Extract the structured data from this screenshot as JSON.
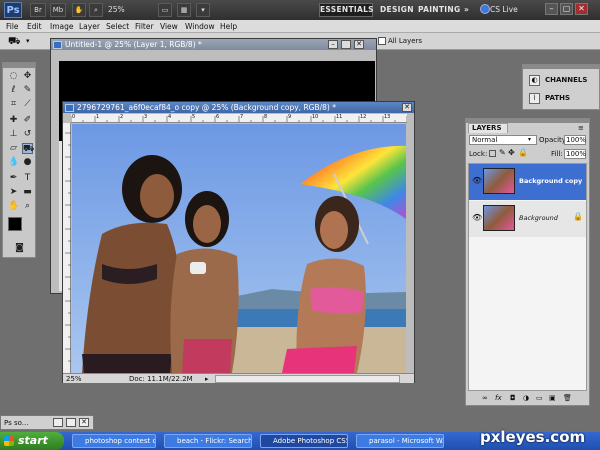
{
  "app": {
    "logo": "Ps",
    "zoom": "25%",
    "workspaces": [
      "ESSENTIALS",
      "DESIGN",
      "PAINTING"
    ],
    "more": "»",
    "cs_live": "CS Live"
  },
  "menu": [
    "File",
    "Edit",
    "Image",
    "Layer",
    "Select",
    "Filter",
    "View",
    "Window",
    "Help"
  ],
  "options": {
    "all_layers": "All Layers"
  },
  "doc_back": {
    "title": "Untitled-1 @ 25% (Layer 1, RGB/8) *"
  },
  "doc_front": {
    "title": "2796729761_a6f0ecaf84_o copy @ 25% (Background copy, RGB/8) *",
    "zoom": "25%",
    "doc_size": "Doc: 11.1M/22.2M",
    "ruler_ticks": [
      "0",
      "1",
      "2",
      "3",
      "4",
      "5",
      "6",
      "7",
      "8",
      "9",
      "10",
      "11",
      "12",
      "13",
      "14"
    ]
  },
  "dock": {
    "channels": "CHANNELS",
    "paths": "PATHS"
  },
  "layers": {
    "tab": "LAYERS",
    "blend_mode": "Normal",
    "opacity_label": "Opacity:",
    "opacity_value": "100%",
    "lock_label": "Lock:",
    "fill_label": "Fill:",
    "fill_value": "100%",
    "items": [
      {
        "name": "Background copy",
        "selected": true
      },
      {
        "name": "Background",
        "selected": false,
        "locked": true
      }
    ]
  },
  "minimized": {
    "label": "Ps so..."
  },
  "taskbar": {
    "start": "start",
    "tasks": [
      "photoshop contest o...",
      "beach - Flickr: Search...",
      "Adobe Photoshop CS5",
      "parasol - Microsoft W..."
    ]
  },
  "watermark": "pxleyes.com"
}
